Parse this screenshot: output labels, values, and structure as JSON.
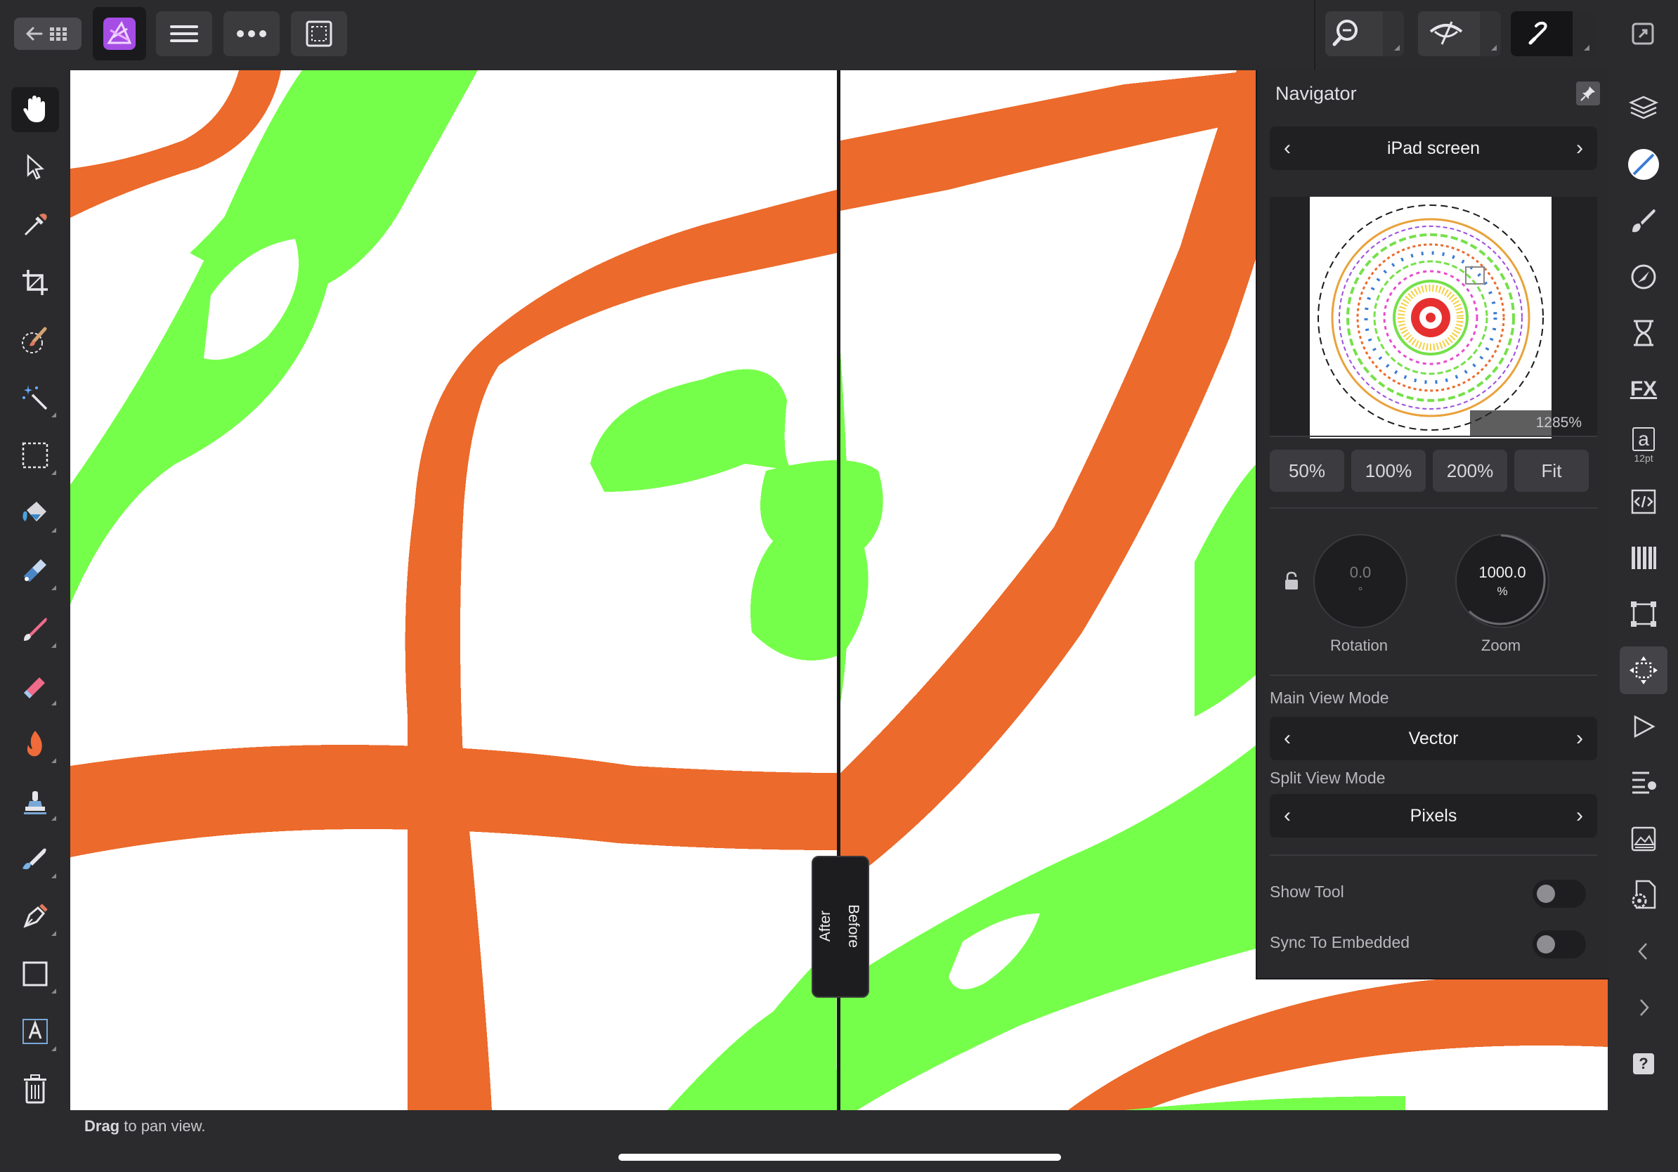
{
  "app": {
    "name": "Affinity Photo"
  },
  "colors": {
    "background": "#2b2b2d",
    "panel": "#2a2a2c",
    "accent_orange": "#ec6a2b",
    "accent_green": "#76ff4a",
    "app_icon": "#a64de6"
  },
  "toolbar": {
    "left": [
      {
        "name": "back-to-home",
        "icon": "arrow-grid-icon"
      },
      {
        "name": "persona",
        "icon": "photo-persona-icon"
      },
      {
        "name": "document-menu",
        "icon": "hamburger-icon"
      },
      {
        "name": "more",
        "icon": "ellipsis-icon"
      },
      {
        "name": "selection",
        "icon": "dotted-rect-icon"
      }
    ],
    "right": [
      {
        "name": "zoom",
        "icon": "magnifier-icon"
      },
      {
        "name": "view-quality",
        "icon": "eye-icon"
      },
      {
        "name": "assistant",
        "icon": "assist-icon"
      },
      {
        "name": "fullscreen",
        "icon": "fullscreen-icon"
      }
    ]
  },
  "left_tools": [
    "hand-tool-icon",
    "move-tool-icon",
    "color-picker-icon",
    "crop-tool-icon",
    "selection-brush-icon",
    "magic-wand-icon",
    "marquee-icon",
    "flood-fill-icon",
    "gradient-icon",
    "paint-brush-icon",
    "erase-brush-icon",
    "dodge-burn-icon",
    "clone-stamp-icon",
    "smudge-icon",
    "pen-tool-icon",
    "rectangle-tool-icon",
    "text-tool-icon",
    "delete-icon"
  ],
  "right_tools": [
    {
      "icon": "layers-icon"
    },
    {
      "icon": "color-icon"
    },
    {
      "icon": "brushes-icon"
    },
    {
      "icon": "adjustments-icon"
    },
    {
      "icon": "history-icon"
    },
    {
      "icon": "fx-icon",
      "label": "FX"
    },
    {
      "icon": "text-style-icon",
      "label": "a",
      "sub": "12pt"
    },
    {
      "icon": "macro-icon"
    },
    {
      "icon": "channels-icon"
    },
    {
      "icon": "transform-icon"
    },
    {
      "icon": "navigator-icon"
    },
    {
      "icon": "play-icon"
    },
    {
      "icon": "stock-icon"
    },
    {
      "icon": "library-icon"
    },
    {
      "icon": "document-settings-icon"
    },
    {
      "icon": "chevron-left-icon"
    },
    {
      "icon": "chevron-right-icon"
    },
    {
      "icon": "help-icon",
      "label": "?"
    }
  ],
  "navigator": {
    "title": "Navigator",
    "preset": "iPad screen",
    "thumbnail_zoom": "1285%",
    "zoom_buttons": [
      "50%",
      "100%",
      "200%",
      "Fit"
    ],
    "rotation": {
      "value": "0.0",
      "unit": "°",
      "label": "Rotation"
    },
    "zoom": {
      "value": "1000.0",
      "unit": "%",
      "label": "Zoom"
    },
    "main_view_mode_label": "Main View Mode",
    "main_view_mode": "Vector",
    "split_view_mode_label": "Split View Mode",
    "split_view_mode": "Pixels",
    "show_tool": {
      "label": "Show Tool",
      "on": false
    },
    "sync_to_embedded": {
      "label": "Sync To Embedded",
      "on": false
    }
  },
  "split_view": {
    "after": "After",
    "before": "Before"
  },
  "status": {
    "action": "Drag",
    "text": " to pan view."
  }
}
